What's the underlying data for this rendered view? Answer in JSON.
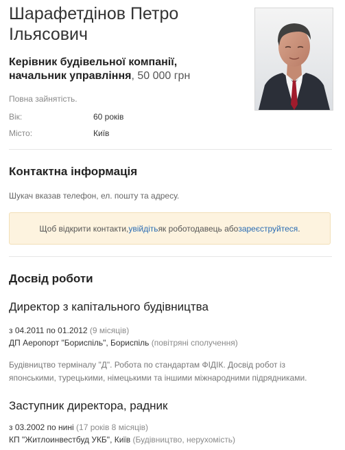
{
  "candidate": {
    "name_line1": "Шарафетдінов Петро",
    "name_line2": "Ільясович",
    "position_line1": "Керівник будівельної компанії,",
    "position_line2": "начальник управління",
    "salary_separator": ", ",
    "salary": "50 000 грн",
    "employment": "Повна зайнятість.",
    "details": [
      {
        "label": "Вік:",
        "value": "60 років"
      },
      {
        "label": "Місто:",
        "value": "Київ"
      }
    ],
    "photo_alt": "person-photo"
  },
  "contact": {
    "heading": "Контактна інформація",
    "note": "Шукач вказав телефон, ел. пошту та адресу.",
    "alert_prefix": "Щоб відкрити контакти, ",
    "login_link": "увійдіть",
    "alert_middle": " як роботодавець або ",
    "register_link": "зареєструйтеся",
    "alert_suffix": "."
  },
  "experience": {
    "heading": "Досвід роботи",
    "jobs": [
      {
        "title": "Директор з капітального будівництва",
        "period": "з 04.2011 по 01.2012",
        "duration": "(9 місяців)",
        "company": "ДП Аеропорт \"Бориспіль\", Бориспіль",
        "industry": "(повітряні сполучення)",
        "description_line1": "Будівництво терміналу \"Д\". Робота по стандартам ФІДІК. Досвід робот із",
        "description_line2": "японськими, турецькими, німецькими та іншими міжнародними підрядниками."
      },
      {
        "title": "Заступник директора, радник",
        "period": "з 03.2002 по нині",
        "duration": "(17 років 8 місяців)",
        "company": "КП \"Житлоинвестбуд УКБ\", Київ",
        "industry": "(Будівництво, нерухомість)"
      }
    ]
  },
  "colors": {
    "link": "#2a6cb3",
    "alert_background": "#fdf3df",
    "alert_border": "#f2dfb7"
  }
}
